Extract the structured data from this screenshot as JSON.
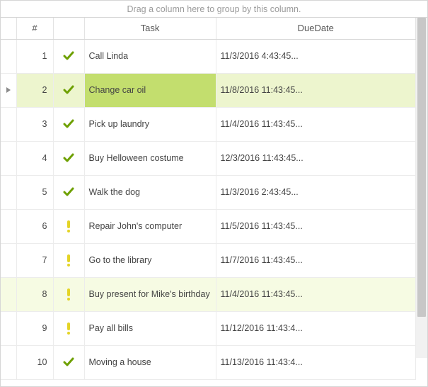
{
  "group_panel": "Drag a column here to group by this column.",
  "columns": {
    "num": "#",
    "status": "",
    "task": "Task",
    "due": "DueDate"
  },
  "icons": {
    "done": "check",
    "warn": "exclamation"
  },
  "selected_index": 1,
  "rows": [
    {
      "n": "1",
      "status": "done",
      "task": "Call Linda",
      "due": "11/3/2016 4:43:45...",
      "highlight": ""
    },
    {
      "n": "2",
      "status": "done",
      "task": "Change car oil",
      "due": "11/8/2016 11:43:45...",
      "highlight": "strong"
    },
    {
      "n": "3",
      "status": "done",
      "task": "Pick up laundry",
      "due": "11/4/2016 11:43:45...",
      "highlight": ""
    },
    {
      "n": "4",
      "status": "done",
      "task": "Buy Helloween costume",
      "due": "12/3/2016 11:43:45...",
      "highlight": ""
    },
    {
      "n": "5",
      "status": "done",
      "task": "Walk the dog",
      "due": "11/3/2016 2:43:45...",
      "highlight": ""
    },
    {
      "n": "6",
      "status": "warn",
      "task": "Repair John's computer",
      "due": "11/5/2016 11:43:45...",
      "highlight": ""
    },
    {
      "n": "7",
      "status": "warn",
      "task": "Go to the library",
      "due": "11/7/2016 11:43:45...",
      "highlight": ""
    },
    {
      "n": "8",
      "status": "warn",
      "task": "Buy present for Mike's birthday",
      "due": "11/4/2016 11:43:45...",
      "highlight": "weak"
    },
    {
      "n": "9",
      "status": "warn",
      "task": "Pay all bills",
      "due": "11/12/2016 11:43:4...",
      "highlight": ""
    },
    {
      "n": "10",
      "status": "done",
      "task": "Moving a house",
      "due": "11/13/2016 11:43:4...",
      "highlight": ""
    }
  ]
}
